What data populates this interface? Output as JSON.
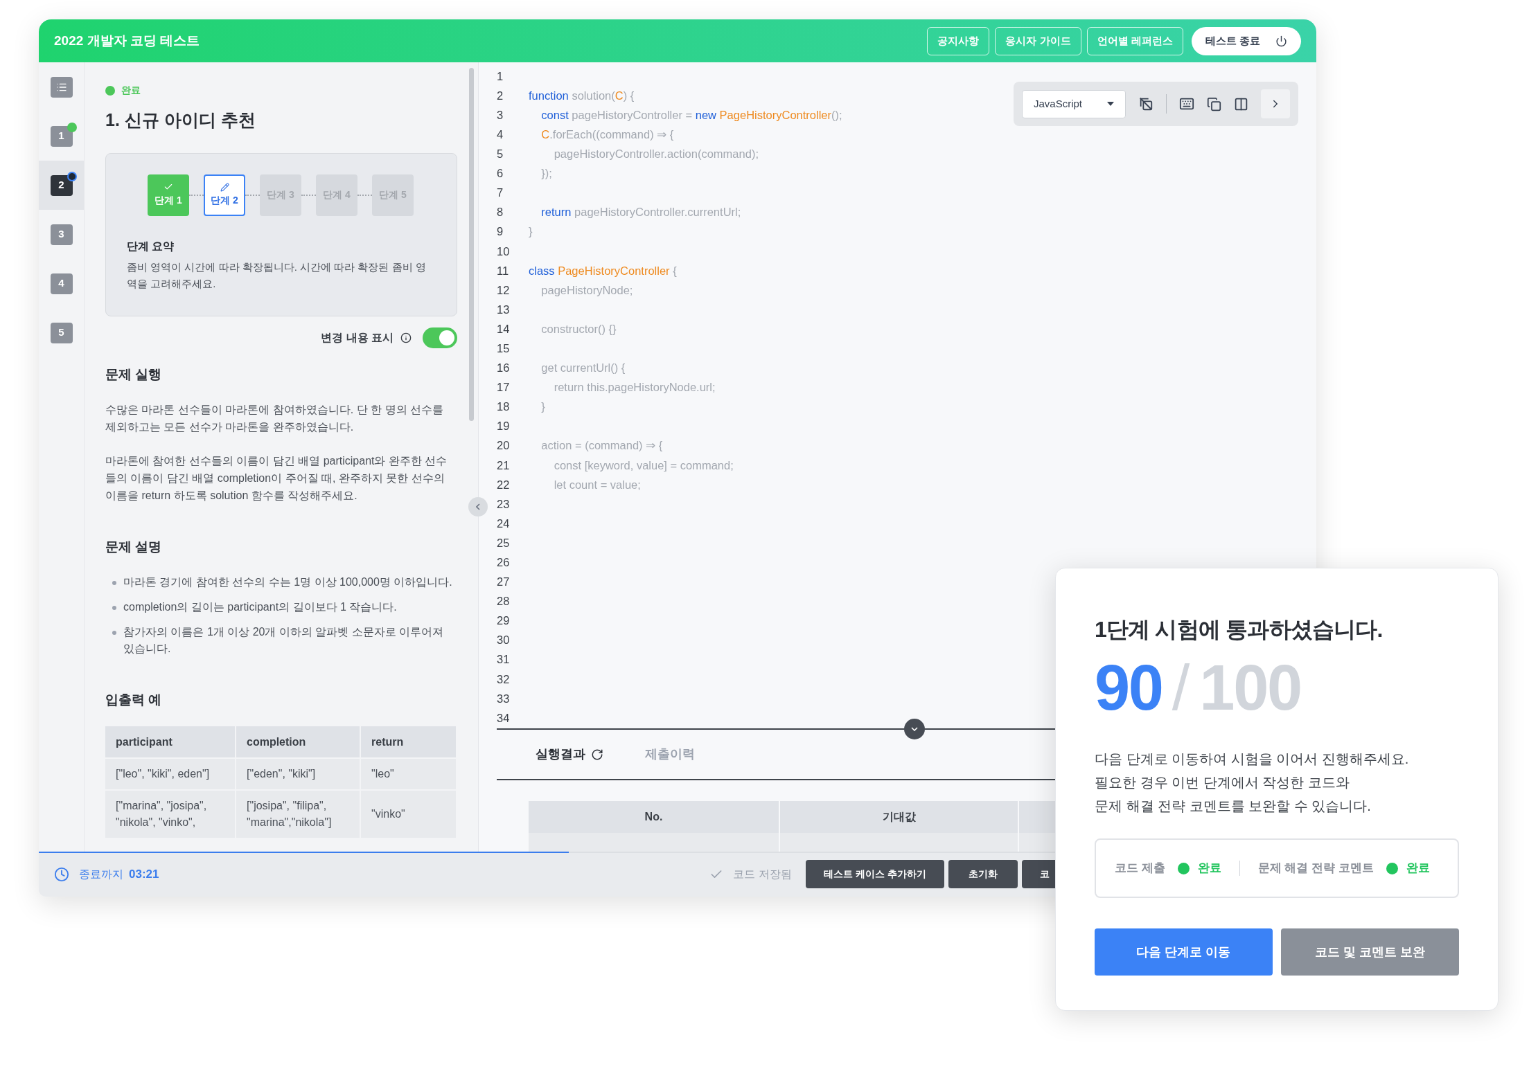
{
  "header": {
    "title": "2022 개발자 코딩 테스트",
    "links": [
      "공지사항",
      "응시자 가이드",
      "언어별 레퍼런스"
    ],
    "end_button": "테스트 종료"
  },
  "nav": {
    "items": [
      {
        "kind": "list",
        "selected": false,
        "done": false,
        "current": false
      },
      {
        "kind": "number",
        "label": "1",
        "selected": false,
        "done": true,
        "current": false
      },
      {
        "kind": "number",
        "label": "2",
        "selected": true,
        "done": false,
        "current": true
      },
      {
        "kind": "number",
        "label": "3",
        "selected": false,
        "done": false,
        "current": false
      },
      {
        "kind": "number",
        "label": "4",
        "selected": false,
        "done": false,
        "current": false
      },
      {
        "kind": "number",
        "label": "5",
        "selected": false,
        "done": false,
        "current": false
      }
    ]
  },
  "problem": {
    "status": "완료",
    "title": "1. 신규 아이디 추천",
    "steps": [
      {
        "label": "단계 1",
        "kind": "done"
      },
      {
        "label": "단계 2",
        "kind": "current"
      },
      {
        "label": "단계 3",
        "kind": "locked"
      },
      {
        "label": "단계 4",
        "kind": "locked"
      },
      {
        "label": "단계 5",
        "kind": "locked"
      }
    ],
    "summary_title": "단계 요약",
    "summary": "좀비 영역이 시간에 따라 확장됩니다. 시간에 따라 확장된 좀비 영역을 고려해주세요.",
    "toggle": {
      "label": "변경 내용 표시",
      "on": true
    },
    "sections": [
      {
        "kind": "paragraphs",
        "heading": "문제 실행",
        "paragraphs": [
          "수많은 마라톤 선수들이 마라톤에 참여하였습니다. 단 한 명의 선수를 제외하고는 모든 선수가 마라톤을 완주하였습니다.",
          "마라톤에 참여한 선수들의 이름이 담긴 배열 participant와 완주한 선수들의 이름이 담긴 배열 completion이 주어질 때, 완주하지 못한 선수의 이름을 return 하도록 solution 함수를 작성해주세요."
        ]
      },
      {
        "kind": "bullets",
        "heading": "문제 설명",
        "bullets": [
          "마라톤 경기에 참여한 선수의 수는 1명 이상 100,000명 이하입니다.",
          "completion의 길이는 participant의 길이보다 1 작습니다.",
          "참가자의 이름은 1개 이상 20개 이하의 알파벳 소문자로 이루어져 있습니다."
        ]
      },
      {
        "kind": "table",
        "heading": "입출력 예",
        "columns": [
          "participant",
          "completion",
          "return"
        ],
        "rows": [
          [
            "[\"leo\", \"kiki\", eden\"]",
            "[\"eden\", \"kiki\"]",
            "\"leo\""
          ],
          [
            "[\"marina\", \"josipa\", \"nikola\", \"vinko\",",
            "[\"josipa\", \"filipa\", \"marina\",\"nikola\"]",
            "\"vinko\""
          ]
        ]
      }
    ]
  },
  "editor": {
    "language": "JavaScript",
    "lines": [
      {
        "number": "1"
      },
      {
        "number": "2",
        "tokens": [
          {
            "text": "function",
            "kind": "keyword"
          },
          {
            "text": " solution(",
            "kind": "plain"
          },
          {
            "text": "C",
            "kind": "name"
          },
          {
            "text": ") {",
            "kind": "plain"
          }
        ]
      },
      {
        "number": "3",
        "tokens": [
          {
            "text": "    const",
            "kind": "keyword"
          },
          {
            "text": " pageHistoryController = ",
            "kind": "plain"
          },
          {
            "text": "new",
            "kind": "keyword"
          },
          {
            "text": " PageHistoryController",
            "kind": "name"
          },
          {
            "text": "();",
            "kind": "plain"
          }
        ]
      },
      {
        "number": "4",
        "tokens": [
          {
            "text": "    C",
            "kind": "name"
          },
          {
            "text": ".forEach((command) ⇒ {",
            "kind": "plain"
          }
        ]
      },
      {
        "number": "5",
        "tokens": [
          {
            "text": "        pageHistoryController.action(command);",
            "kind": "plain"
          }
        ]
      },
      {
        "number": "6",
        "tokens": [
          {
            "text": "    });",
            "kind": "plain"
          }
        ]
      },
      {
        "number": "7"
      },
      {
        "number": "8",
        "tokens": [
          {
            "text": "    return",
            "kind": "keyword"
          },
          {
            "text": " pageHistoryController.currentUrl;",
            "kind": "plain"
          }
        ]
      },
      {
        "number": "9",
        "tokens": [
          {
            "text": "}",
            "kind": "plain"
          }
        ]
      },
      {
        "number": "10"
      },
      {
        "number": "11",
        "tokens": [
          {
            "text": "class",
            "kind": "keyword"
          },
          {
            "text": " PageHistoryController",
            "kind": "name"
          },
          {
            "text": " {",
            "kind": "plain"
          }
        ]
      },
      {
        "number": "12",
        "tokens": [
          {
            "text": "    pageHistoryNode;",
            "kind": "plain"
          }
        ]
      },
      {
        "number": "13"
      },
      {
        "number": "14",
        "tokens": [
          {
            "text": "    constructor() {}",
            "kind": "plain"
          }
        ]
      },
      {
        "number": "15"
      },
      {
        "number": "16",
        "tokens": [
          {
            "text": "    get currentUrl() {",
            "kind": "plain"
          }
        ]
      },
      {
        "number": "17",
        "tokens": [
          {
            "text": "        return this.pageHistoryNode.url;",
            "kind": "plain"
          }
        ]
      },
      {
        "number": "18",
        "tokens": [
          {
            "text": "    }",
            "kind": "plain"
          }
        ]
      },
      {
        "number": "19"
      },
      {
        "number": "20",
        "tokens": [
          {
            "text": "    action = (command) ⇒ {",
            "kind": "plain"
          }
        ]
      },
      {
        "number": "21",
        "tokens": [
          {
            "text": "        const [keyword, value] = command;",
            "kind": "plain"
          }
        ]
      },
      {
        "number": "22",
        "tokens": [
          {
            "text": "        let count = value;",
            "kind": "plain"
          }
        ]
      },
      {
        "number": "23"
      },
      {
        "number": "24"
      },
      {
        "number": "25"
      },
      {
        "number": "26"
      },
      {
        "number": "27"
      },
      {
        "number": "28"
      },
      {
        "number": "29"
      },
      {
        "number": "30"
      },
      {
        "number": "31"
      },
      {
        "number": "32"
      },
      {
        "number": "33"
      },
      {
        "number": "34"
      }
    ]
  },
  "results": {
    "tabs": [
      {
        "label": "실행결과",
        "selected": true,
        "loading": true
      },
      {
        "label": "제출이력",
        "selected": false,
        "loading": false
      }
    ],
    "columns": [
      "No.",
      "기대값"
    ]
  },
  "footer": {
    "timer_label": "종료까지",
    "timer": "03:21",
    "progress": {
      "level": 0.415
    },
    "save_status": "코드 저장됨",
    "buttons": [
      "테스트 케이스 추가하기",
      "초기화",
      "코"
    ]
  },
  "modal": {
    "title": "1단계 시험에 통과하셨습니다.",
    "score": "90",
    "separator": "/",
    "total": "100",
    "message": [
      "다음 단계로 이동하여 시험을 이어서 진행해주세요.",
      "필요한 경우 이번 단계에서 작성한 코드와",
      "문제 해결 전략 코멘트를 보완할 수 있습니다."
    ],
    "checks": [
      {
        "label": "코드 제출",
        "status": "완료",
        "color": "#22c55e"
      },
      {
        "label": "문제 해결 전략 코멘트",
        "status": "완료",
        "color": "#22c55e"
      }
    ],
    "buttons": [
      {
        "label": "다음 단계로 이동",
        "kind": "primary"
      },
      {
        "label": "코드 및 코멘트 보완",
        "kind": "secondary"
      }
    ]
  }
}
